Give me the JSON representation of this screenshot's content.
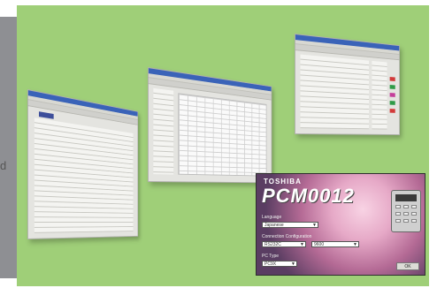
{
  "left_strip": {
    "cut_text": "d"
  },
  "dialog": {
    "brand": "TOSHIBA",
    "product": "PCM0012",
    "fields": [
      {
        "label": "Language",
        "value": "Japanese"
      },
      {
        "label": "Connection Configuration",
        "value": "RS232C",
        "value2": "9600"
      },
      {
        "label": "PC Type",
        "value": "PC9X"
      }
    ],
    "ok_label": "OK"
  },
  "colors": {
    "background": "#9fcf78",
    "titlebar": "#3a63b8",
    "side_gray": "#8e8f93"
  }
}
